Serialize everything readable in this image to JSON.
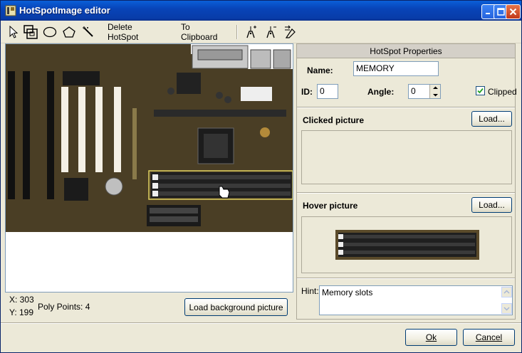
{
  "window": {
    "title": "HotSpotImage editor"
  },
  "toolbar": {
    "delete_label": "Delete HotSpot",
    "clipboard_label": "To Clipboard"
  },
  "status": {
    "x_label": "X: 303",
    "y_label": "Y: 199",
    "poly_points": "Poly Points: 4"
  },
  "buttons": {
    "load_background": "Load background picture",
    "load_clicked": "Load...",
    "load_hover": "Load...",
    "ok": "Ok",
    "cancel": "Cancel"
  },
  "properties": {
    "header": "HotSpot Properties",
    "name_label": "Name:",
    "name_value": "MEMORY",
    "id_label": "ID:",
    "id_value": "0",
    "angle_label": "Angle:",
    "angle_value": "0",
    "clipped_label": "Clipped",
    "clipped_checked": true,
    "clicked_picture_label": "Clicked picture",
    "hover_picture_label": "Hover picture",
    "hint_label": "Hint:",
    "hint_value": "Memory slots"
  },
  "colors": {
    "title_bar": "#0844b8",
    "window_bg": "#ece9d8",
    "selection_outline": "#e0d060"
  }
}
